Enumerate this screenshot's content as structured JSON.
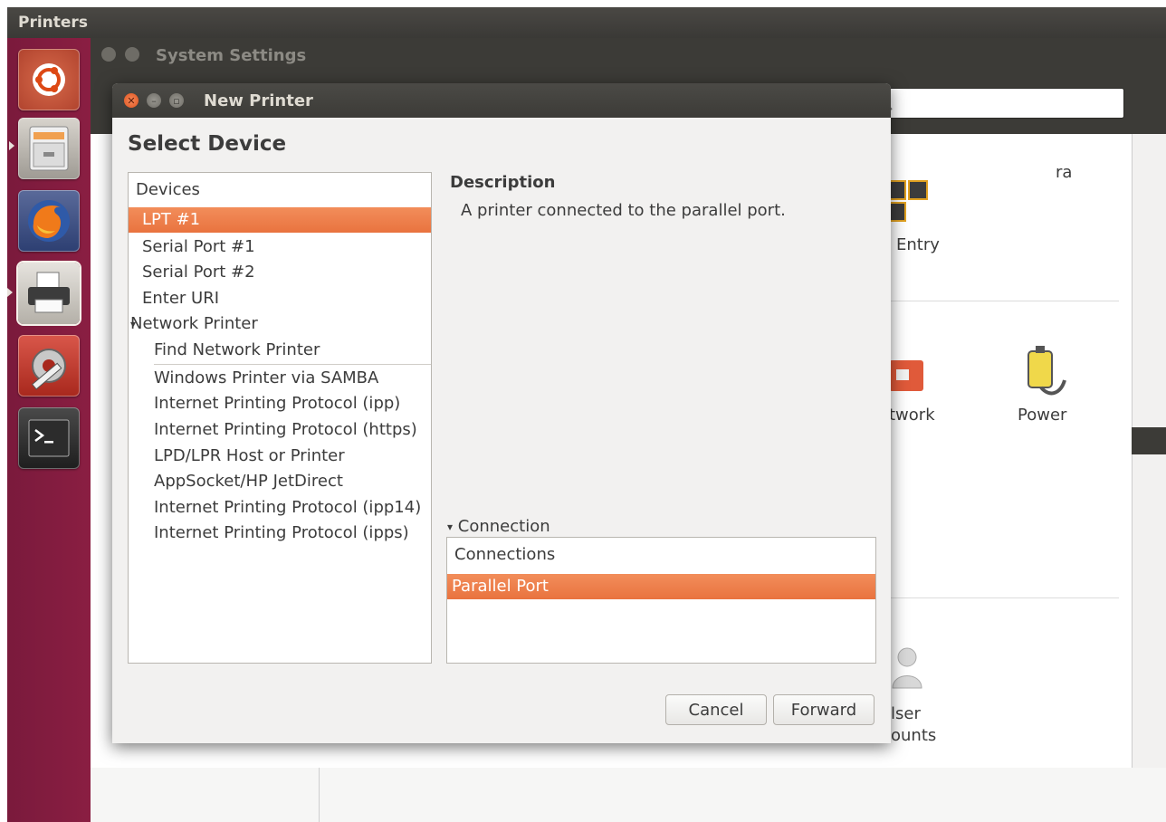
{
  "top_panel": {
    "title": "Printers"
  },
  "launcher": {
    "items": [
      {
        "icon": "ubuntu-dash-icon"
      },
      {
        "icon": "file-manager-icon"
      },
      {
        "icon": "firefox-icon"
      },
      {
        "icon": "printer-icon"
      },
      {
        "icon": "system-settings-icon"
      },
      {
        "icon": "terminal-icon"
      }
    ]
  },
  "settings_window": {
    "title": "System Settings",
    "partial_labels": {
      "top_right": "ra",
      "entry": "Entry",
      "network": "twork",
      "power": "Power",
      "user": "lser",
      "accounts": "ounts"
    }
  },
  "dialog": {
    "title": "New Printer",
    "heading": "Select Device",
    "devices_header": "Devices",
    "devices": [
      {
        "label": "LPT #1",
        "selected": true,
        "indent": 1
      },
      {
        "label": "Serial Port #1",
        "selected": false,
        "indent": 1
      },
      {
        "label": "Serial Port #2",
        "selected": false,
        "indent": 1
      },
      {
        "label": "Enter URI",
        "selected": false,
        "indent": 1
      },
      {
        "label": "Network Printer",
        "selected": false,
        "indent": 0,
        "expander": "▾"
      },
      {
        "label": "Find Network Printer",
        "selected": false,
        "indent": 2
      },
      {
        "label": "Windows Printer via SAMBA",
        "selected": false,
        "indent": 2
      },
      {
        "label": "Internet Printing Protocol (ipp)",
        "selected": false,
        "indent": 2
      },
      {
        "label": "Internet Printing Protocol (https)",
        "selected": false,
        "indent": 2
      },
      {
        "label": "LPD/LPR Host or Printer",
        "selected": false,
        "indent": 2
      },
      {
        "label": "AppSocket/HP JetDirect",
        "selected": false,
        "indent": 2
      },
      {
        "label": "Internet Printing Protocol (ipp14)",
        "selected": false,
        "indent": 2
      },
      {
        "label": "Internet Printing Protocol (ipps)",
        "selected": false,
        "indent": 2
      }
    ],
    "description_label": "Description",
    "description_text": "A printer connected to the parallel port.",
    "connection_expander": "Connection",
    "connection_expander_glyph": "▾",
    "connections_header": "Connections",
    "connection_selected": "Parallel Port",
    "buttons": {
      "cancel": "Cancel",
      "forward": "Forward"
    }
  },
  "colors": {
    "selection": "#e9733f",
    "launcher": "#7a1a3c",
    "titlebar": "#3c3b37",
    "close_button": "#e8652f"
  }
}
